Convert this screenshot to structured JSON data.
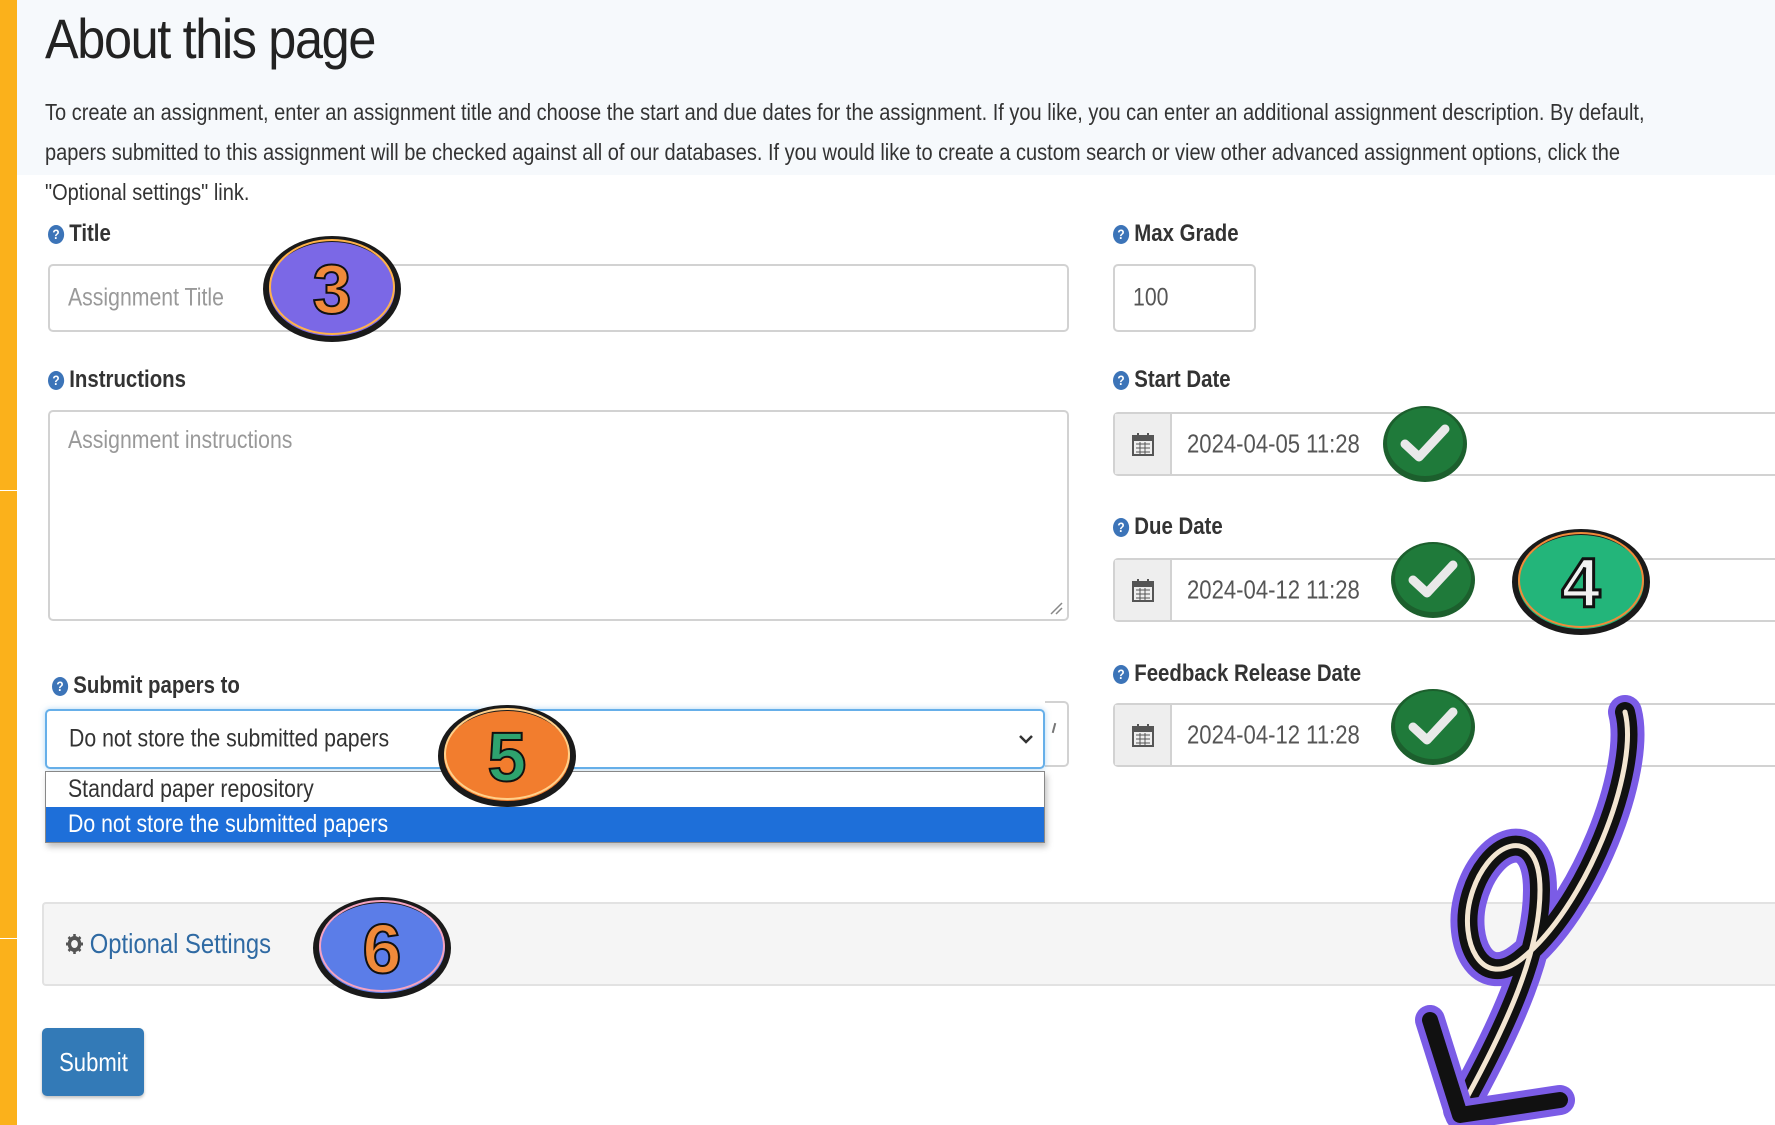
{
  "page": {
    "title": "About this page",
    "intro": "To create an assignment, enter an assignment title and choose the start and due dates for the assignment. If you like, you can enter an additional assignment description. By default, papers submitted to this assignment will be checked against all of our databases. If you would like to create a custom search or view other advanced assignment options, click the \"Optional settings\" link."
  },
  "form": {
    "title": {
      "label": "Title",
      "placeholder": "Assignment Title"
    },
    "instructions": {
      "label": "Instructions",
      "placeholder": "Assignment instructions"
    },
    "submit_to": {
      "label": "Submit papers to",
      "selected": "Do not store the submitted papers",
      "options": [
        "Standard paper repository",
        "Do not store the submitted papers"
      ]
    },
    "max_grade": {
      "label": "Max Grade",
      "value": "100"
    },
    "start_date": {
      "label": "Start Date",
      "value": "2024-04-05 11:28"
    },
    "due_date": {
      "label": "Due Date",
      "value": "2024-04-12 11:28"
    },
    "feedback_date": {
      "label": "Feedback Release Date",
      "value": "2024-04-12 11:28"
    },
    "optional_settings": {
      "label": "Optional Settings"
    },
    "submit_label": "Submit",
    "help_glyph": "?"
  },
  "annotations": {
    "badge_3": "3",
    "badge_4": "4",
    "badge_5": "5",
    "badge_6": "6"
  },
  "colors": {
    "sidebar": "#fbb11b",
    "primary": "#337ab7",
    "selected_option": "#1e6fd9",
    "check_badge": "#1f7a3a",
    "badge_3": "#7b68e6",
    "badge_4": "#23b57a",
    "badge_5": "#f27d2e",
    "badge_6": "#5b7de8",
    "arrow_outline": "#7b5ce6"
  },
  "icons": [
    "help-icon",
    "calendar-icon",
    "gear-icon",
    "chevron-down-icon",
    "checkmark-icon",
    "arrow-icon"
  ]
}
